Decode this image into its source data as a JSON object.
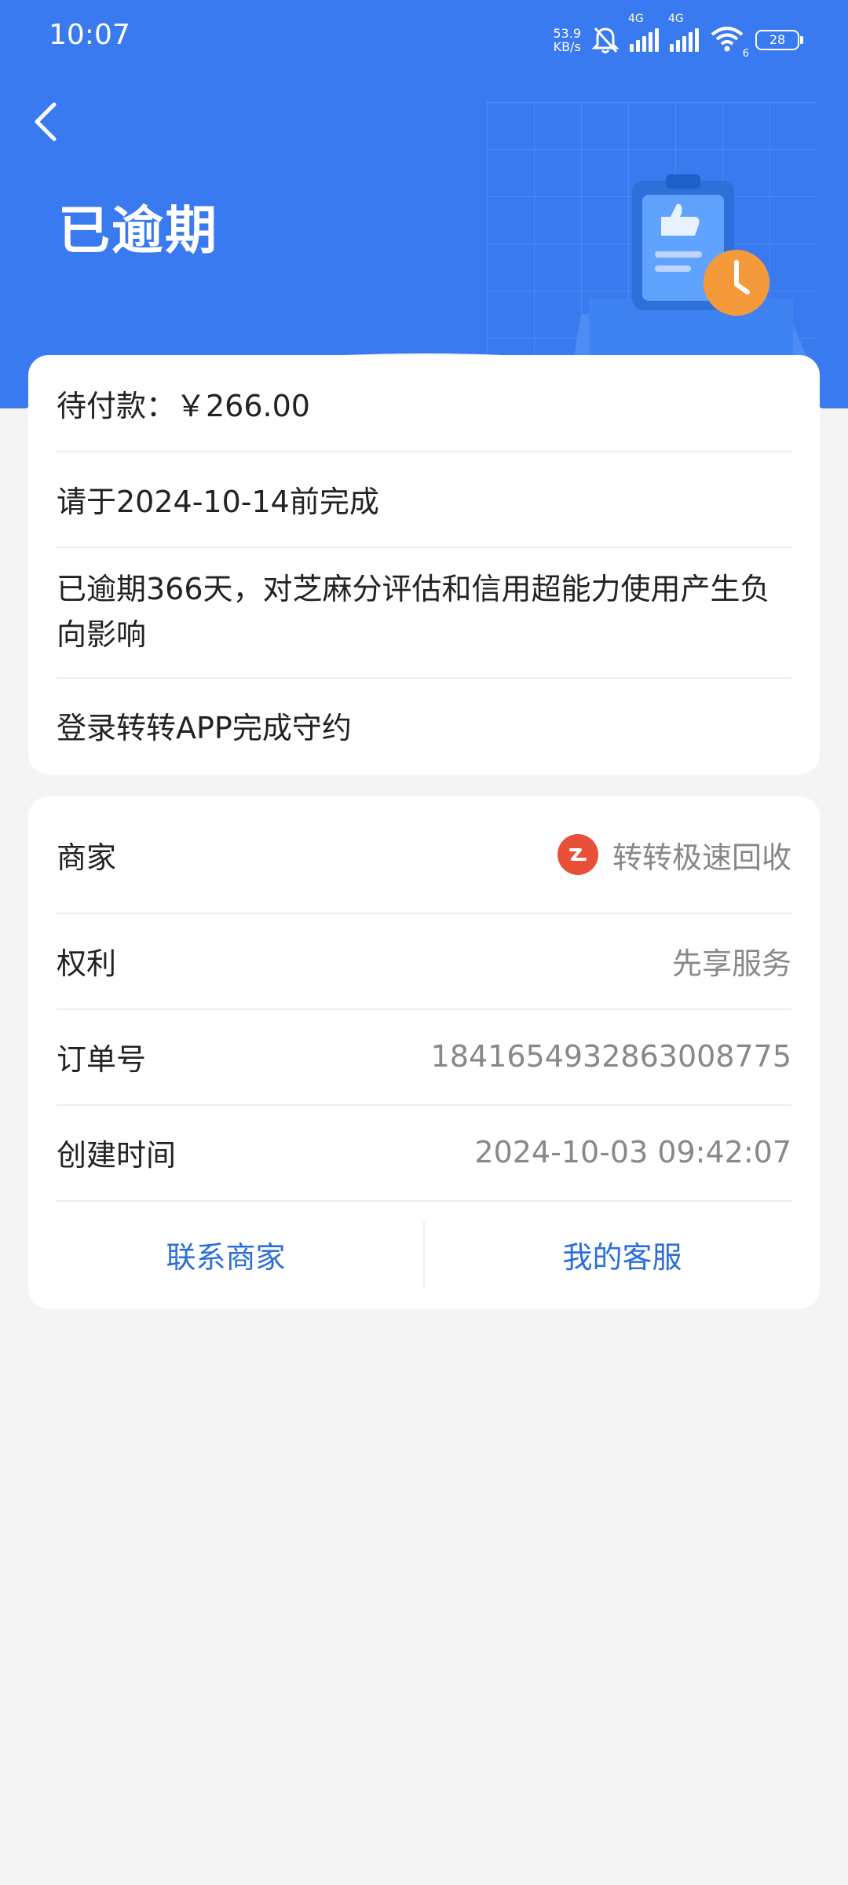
{
  "status_bar": {
    "time": "10:07",
    "net_speed_value": "53.9",
    "net_speed_unit": "KB/s",
    "signal1_label": "4G",
    "signal2_label": "4G",
    "wifi_sub": "6",
    "battery": "28",
    "icons": [
      "mute-bell-icon",
      "signal-icon",
      "signal-icon",
      "wifi-icon",
      "battery-icon"
    ]
  },
  "header": {
    "title": "已逾期",
    "back_icon": "chevron-left-icon",
    "illustration_icon": "clipboard-clock-icon",
    "colors": {
      "primary": "#3a7af0",
      "accent_orange": "#f59a3b"
    }
  },
  "summary_card": {
    "amount_line": "待付款：￥266.00",
    "deadline_line": "请于2024-10-14前完成",
    "overdue_line": "已逾期366天，对芝麻分评估和信用超能力使用产生负向影响",
    "action_line": "登录转转APP完成守约"
  },
  "detail_card": {
    "merchant_label": "商家",
    "merchant_value": "转转极速回收",
    "merchant_logo_color": "#e8503a",
    "rights_label": "权利",
    "rights_value": "先享服务",
    "order_label": "订单号",
    "order_value": "1841654932863008775",
    "created_label": "创建时间",
    "created_value": "2024-10-03 09:42:07",
    "contact_merchant": "联系商家",
    "my_service": "我的客服",
    "link_color": "#2d6fd8"
  }
}
